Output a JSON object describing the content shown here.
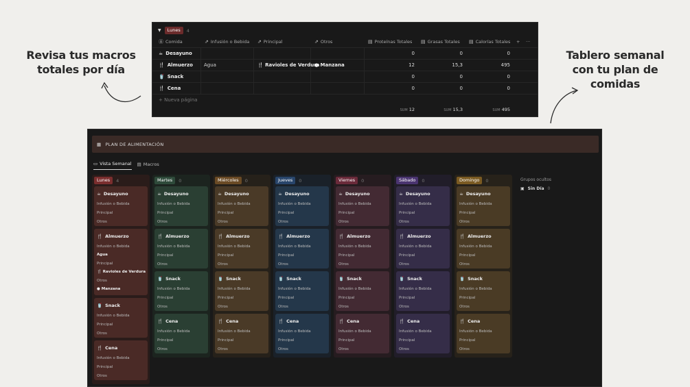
{
  "callouts": {
    "left": [
      "Revisa tus macros",
      "totales por día"
    ],
    "right": [
      "Tablero semanal",
      "con tu plan de",
      "comidas"
    ]
  },
  "table": {
    "group": {
      "label": "Lunes",
      "count": "4",
      "color": "#6b2b2b"
    },
    "columns": [
      "Comida",
      "Infusión o Bebida",
      "Principal",
      "Otros",
      "Proteínas Totales",
      "Grasas Totales",
      "Calorías Totales"
    ],
    "add_col": "+",
    "more": "···",
    "rows": [
      {
        "icon": "☕",
        "name": "Desayuno",
        "bebida": "",
        "principal": "",
        "otros": "",
        "prot": "0",
        "gras": "0",
        "cal": "0"
      },
      {
        "icon": "🍴",
        "name": "Almuerzo",
        "bebida": "Agua",
        "principal": "Ravioles de Verdura",
        "otros": "Manzana",
        "prot": "12",
        "gras": "15,3",
        "cal": "495"
      },
      {
        "icon": "🥤",
        "name": "Snack",
        "bebida": "",
        "principal": "",
        "otros": "",
        "prot": "0",
        "gras": "0",
        "cal": "0"
      },
      {
        "icon": "🍴",
        "name": "Cena",
        "bebida": "",
        "principal": "",
        "otros": "",
        "prot": "0",
        "gras": "0",
        "cal": "0"
      }
    ],
    "new_page": "Nueva página",
    "sums": {
      "label": "SUM",
      "prot": "12",
      "gras": "15,3",
      "cal": "495"
    }
  },
  "board": {
    "title": "PLAN DE ALIMENTACIÓN",
    "tabs": [
      "Vista Semanal",
      "Macros"
    ],
    "days": [
      {
        "name": "Lunes",
        "count": "4",
        "tag": "#7a2e2e",
        "bg": "#2a1c1a",
        "card": "#4a2a26"
      },
      {
        "name": "Martes",
        "count": "0",
        "tag": "#2e4a3a",
        "bg": "#1c241f",
        "card": "#2a3f33"
      },
      {
        "name": "Miércoles",
        "count": "0",
        "tag": "#6a4a25",
        "bg": "#26211a",
        "card": "#4a3a27"
      },
      {
        "name": "Jueves",
        "count": "0",
        "tag": "#28456b",
        "bg": "#1a2129",
        "card": "#24374a"
      },
      {
        "name": "Viernes",
        "count": "0",
        "tag": "#6a2a3a",
        "bg": "#261c20",
        "card": "#432a33"
      },
      {
        "name": "Sábado",
        "count": "0",
        "tag": "#4a3470",
        "bg": "#211d29",
        "card": "#352d48"
      },
      {
        "name": "Domingo",
        "count": "0",
        "tag": "#7a5a22",
        "bg": "#27221a",
        "card": "#4a3b25"
      }
    ],
    "meals": [
      {
        "icon": "☕",
        "name": "Desayuno"
      },
      {
        "icon": "🍴",
        "name": "Almuerzo"
      },
      {
        "icon": "🥤",
        "name": "Snack"
      },
      {
        "icon": "🍴",
        "name": "Cena"
      }
    ],
    "fields": [
      "Infusión o Bebida",
      "Principal",
      "Otros"
    ],
    "monday_almuerzo": {
      "bebida": "Agua",
      "principal": "Ravioles de Verdura",
      "otros": "Manzana"
    },
    "hidden_groups": "Grupos ocultos",
    "no_day": {
      "label": "Sin Día",
      "count": "0"
    }
  }
}
